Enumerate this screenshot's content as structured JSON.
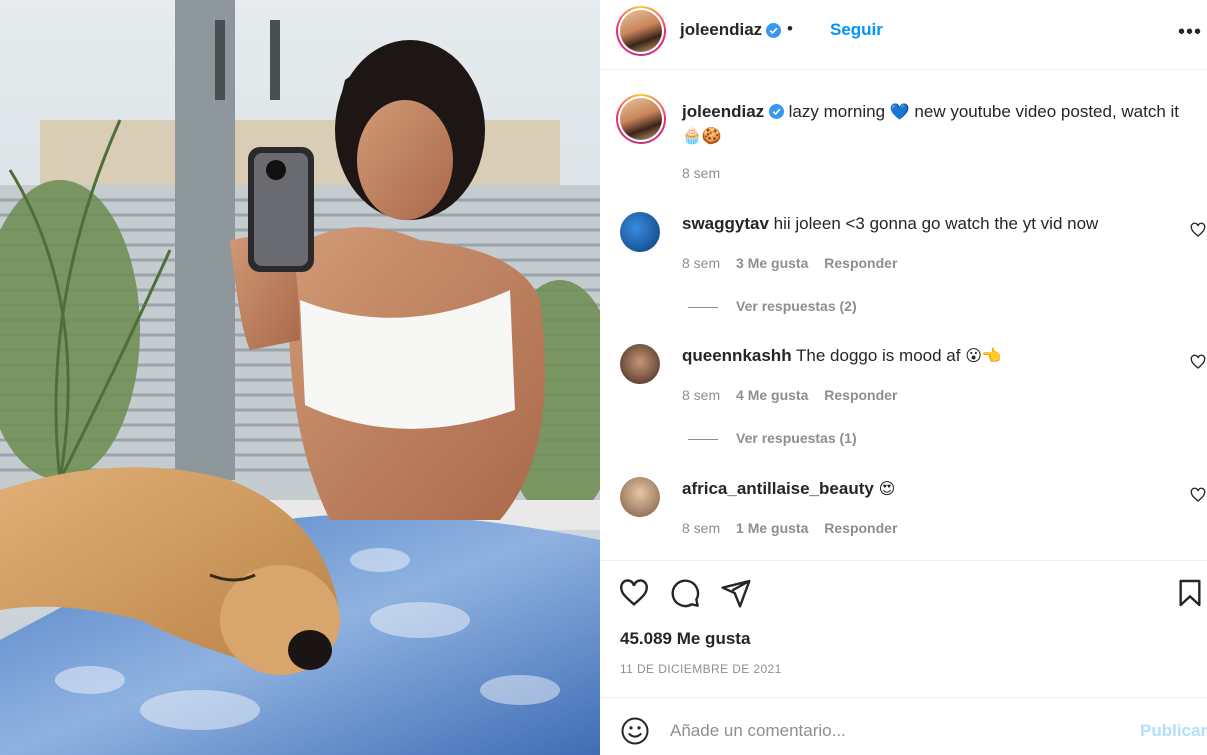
{
  "post_image": {
    "description_icon": "selfie-photo"
  },
  "header": {
    "username": "joleendiaz",
    "separator": "•",
    "follow_label": "Seguir",
    "more_icon": "more-options-icon"
  },
  "caption": {
    "username": "joleendiaz",
    "text": "lazy morning",
    "emoji_1": "💙",
    "text_2": "new youtube video posted, watch it",
    "emoji_2": "🧁",
    "emoji_3": "🍪",
    "time": "8 sem"
  },
  "comments": [
    {
      "username": "swaggytav",
      "text": "hii joleen <3 gonna go watch the yt vid now",
      "emoji": "",
      "time": "8 sem",
      "likes": "3 Me gusta",
      "reply_label": "Responder",
      "view_replies": "Ver respuestas (2)"
    },
    {
      "username": "queennkashh",
      "text": "The doggo is mood af",
      "emoji": "😮👈",
      "time": "8 sem",
      "likes": "4 Me gusta",
      "reply_label": "Responder",
      "view_replies": "Ver respuestas (1)"
    },
    {
      "username": "africa_antillaise_beauty",
      "text": "",
      "emoji": "😍",
      "time": "8 sem",
      "likes": "1 Me gusta",
      "reply_label": "Responder"
    }
  ],
  "actions": {
    "like_icon": "heart-icon",
    "comment_icon": "comment-icon",
    "share_icon": "share-icon",
    "save_icon": "bookmark-icon"
  },
  "likes_count": "45.089 Me gusta",
  "date": "11 DE DICIEMBRE DE 2021",
  "add_comment": {
    "placeholder": "Añade un comentario...",
    "publish_label": "Publicar"
  },
  "colors": {
    "link": "#0095f6",
    "publish_disabled": "#b2dffc",
    "muted": "#8e8e8e",
    "verified": "#3897f0"
  }
}
